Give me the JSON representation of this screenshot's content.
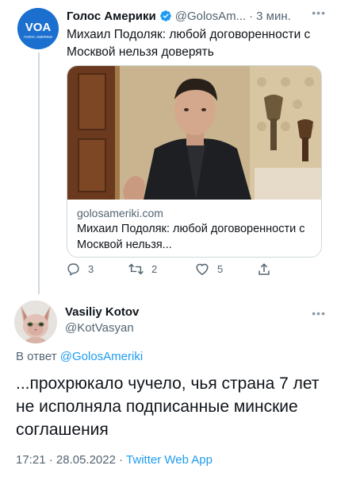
{
  "parent_tweet": {
    "display_name": "Голос Америки",
    "handle": "@GolosAm...",
    "separator": "·",
    "time": "3 мин.",
    "text": "Михаил Подоляк: любой договоренности с Москвой нельзя доверять",
    "avatar_logo_text": "VOA",
    "avatar_caption": "ГОЛОС АМЕРИКИ",
    "card": {
      "domain": "golosameriki.com",
      "title": "Михаил Подоляк: любой договоренности с Москвой нельзя..."
    },
    "actions": {
      "reply_count": "3",
      "retweet_count": "2",
      "like_count": "5"
    }
  },
  "reply_tweet": {
    "display_name": "Vasiliy Kotov",
    "handle": "@KotVasyan",
    "reply_prefix": "В ответ",
    "reply_mention": "@GolosAmeriki",
    "text": "...прохрюкало чучело, чья страна 7 лет не исполняла подписанные минские соглашения",
    "time": "17:21",
    "separator": "·",
    "date": "28.05.2022",
    "app": "Twitter Web App"
  },
  "colors": {
    "accent": "#1d9bf0",
    "secondary_text": "#536471",
    "voa_blue": "#1a6fcf",
    "border": "#cfd9de"
  },
  "icons": [
    "verified-badge-icon",
    "more-icon",
    "reply-icon",
    "retweet-icon",
    "like-icon",
    "share-icon"
  ]
}
